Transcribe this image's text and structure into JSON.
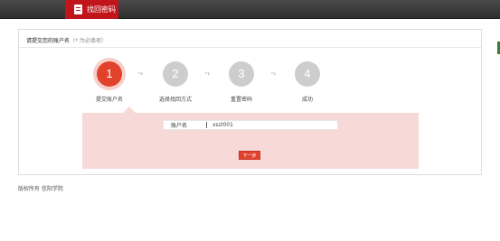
{
  "header": {
    "title": "找回密码",
    "icon": "document-icon",
    "brand_color": "#c0161b"
  },
  "panel": {
    "instruction": "请提交您的账户名",
    "hint": "（* 为必填项）"
  },
  "steps": [
    {
      "number": "1",
      "label": "提交账户名",
      "active": true
    },
    {
      "number": "2",
      "label": "选择找回方式",
      "active": false
    },
    {
      "number": "3",
      "label": "重置密码",
      "active": false
    },
    {
      "number": "4",
      "label": "成功",
      "active": false
    }
  ],
  "step_colors": {
    "active": "#e2422c",
    "inactive": "#cdcdcd"
  },
  "form": {
    "account_label": "账户名",
    "account_value": "xszl001",
    "next_button": "下一步"
  },
  "footer": {
    "text": "版权所有 信阳学院"
  }
}
